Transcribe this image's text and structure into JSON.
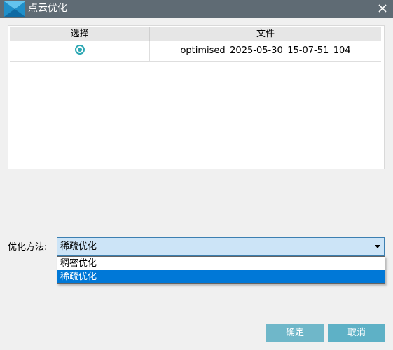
{
  "window": {
    "title": "点云优化",
    "icons": {
      "app": "app-logo-icon",
      "close": "close-icon"
    }
  },
  "grid": {
    "columns": [
      "选择",
      "文件"
    ],
    "rows": [
      {
        "selected": true,
        "file": "optimised_2025-05-30_15-07-51_104"
      }
    ]
  },
  "method": {
    "label": "优化方法:",
    "value": "稀疏优化",
    "options": [
      "稠密优化",
      "稀疏优化"
    ],
    "highlighted": "稀疏优化"
  },
  "buttons": {
    "ok": "确定",
    "cancel": "取消"
  },
  "colors": {
    "titlebar": "#5f6b74",
    "accent": "#2ba7b3",
    "selection": "#0078d7",
    "button": "#6fb7c9"
  }
}
